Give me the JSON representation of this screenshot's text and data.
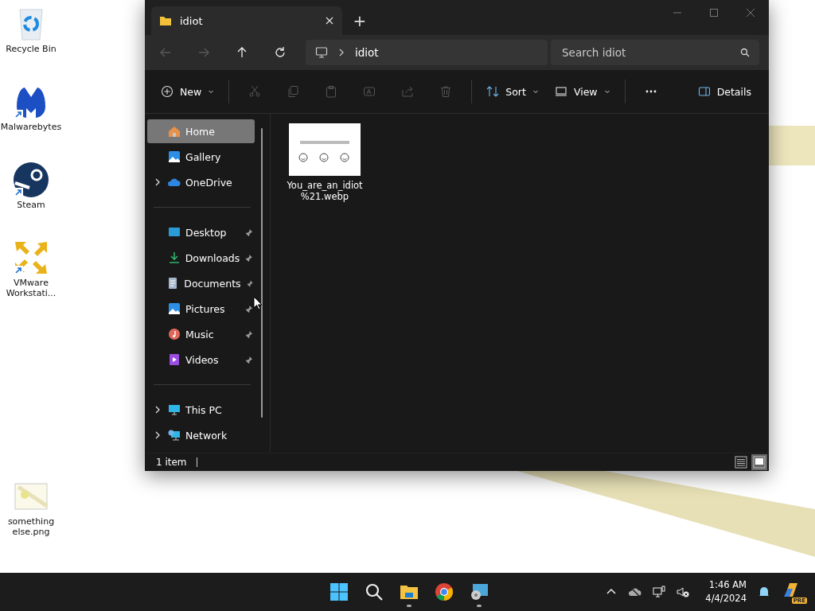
{
  "desktop": {
    "icons": [
      {
        "label": "Recycle Bin",
        "kind": "recycle",
        "shortcut": false
      },
      {
        "label": "Malwarebytes",
        "kind": "malwarebytes",
        "shortcut": true
      },
      {
        "label": "Steam",
        "kind": "steam",
        "shortcut": true
      },
      {
        "label": "VMware Workstati...",
        "kind": "vmware",
        "shortcut": true
      },
      {
        "label": "something else.png",
        "kind": "image",
        "shortcut": false
      }
    ]
  },
  "window": {
    "tab": {
      "title": "idiot"
    },
    "new_tab": "+",
    "nav": [
      {
        "kind": "back",
        "disabled": true
      },
      {
        "kind": "forward",
        "disabled": true
      },
      {
        "kind": "up",
        "disabled": false
      },
      {
        "kind": "refresh",
        "disabled": false
      }
    ],
    "address": {
      "path": "idiot"
    },
    "search": {
      "placeholder": "Search idiot"
    },
    "toolbar": [
      {
        "kind": "new",
        "label": "New",
        "disabled": false,
        "dropdown": true
      },
      {
        "kind": "cut",
        "disabled": true
      },
      {
        "kind": "copy",
        "disabled": true
      },
      {
        "kind": "paste",
        "disabled": true
      },
      {
        "kind": "rename",
        "disabled": true
      },
      {
        "kind": "share",
        "disabled": true
      },
      {
        "kind": "delete",
        "disabled": true
      },
      {
        "kind": "sort",
        "label": "Sort",
        "disabled": false,
        "dropdown": true
      },
      {
        "kind": "view",
        "label": "View",
        "disabled": false,
        "dropdown": true
      },
      {
        "kind": "more",
        "disabled": false
      },
      {
        "kind": "details",
        "label": "Details",
        "disabled": false
      }
    ],
    "sidebar": {
      "groups": [
        [
          {
            "label": "Home",
            "kind": "home",
            "selected": true,
            "expandable": false,
            "pinned": false
          },
          {
            "label": "Gallery",
            "kind": "gallery",
            "selected": false,
            "expandable": false,
            "pinned": false
          },
          {
            "label": "OneDrive",
            "kind": "cloud",
            "selected": false,
            "expandable": true,
            "pinned": false
          }
        ],
        [
          {
            "label": "Desktop",
            "kind": "desktop",
            "selected": false,
            "expandable": false,
            "pinned": true
          },
          {
            "label": "Downloads",
            "kind": "downloads",
            "selected": false,
            "expandable": false,
            "pinned": true
          },
          {
            "label": "Documents",
            "kind": "documents",
            "selected": false,
            "expandable": false,
            "pinned": true
          },
          {
            "label": "Pictures",
            "kind": "pictures",
            "selected": false,
            "expandable": false,
            "pinned": true
          },
          {
            "label": "Music",
            "kind": "music",
            "selected": false,
            "expandable": false,
            "pinned": true
          },
          {
            "label": "Videos",
            "kind": "videos",
            "selected": false,
            "expandable": false,
            "pinned": true
          }
        ],
        [
          {
            "label": "This PC",
            "kind": "pc",
            "selected": false,
            "expandable": true,
            "pinned": false
          },
          {
            "label": "Network",
            "kind": "network",
            "selected": false,
            "expandable": true,
            "pinned": false
          }
        ]
      ]
    },
    "files": [
      {
        "name": "You_are_an_idiot %21.webp",
        "selected": false
      }
    ],
    "status_bar": {
      "count": "1 item",
      "views": [
        {
          "kind": "details",
          "selected": false
        },
        {
          "kind": "tiles",
          "selected": true
        }
      ]
    }
  },
  "taskbar": {
    "apps": [
      {
        "kind": "start",
        "running": false
      },
      {
        "kind": "search",
        "running": false
      },
      {
        "kind": "explorer",
        "running": true
      },
      {
        "kind": "chrome",
        "running": false
      },
      {
        "kind": "remote",
        "running": true
      }
    ],
    "tray": {
      "time": "1:46 AM",
      "date": "4/4/2024",
      "badge": "PRE"
    }
  }
}
